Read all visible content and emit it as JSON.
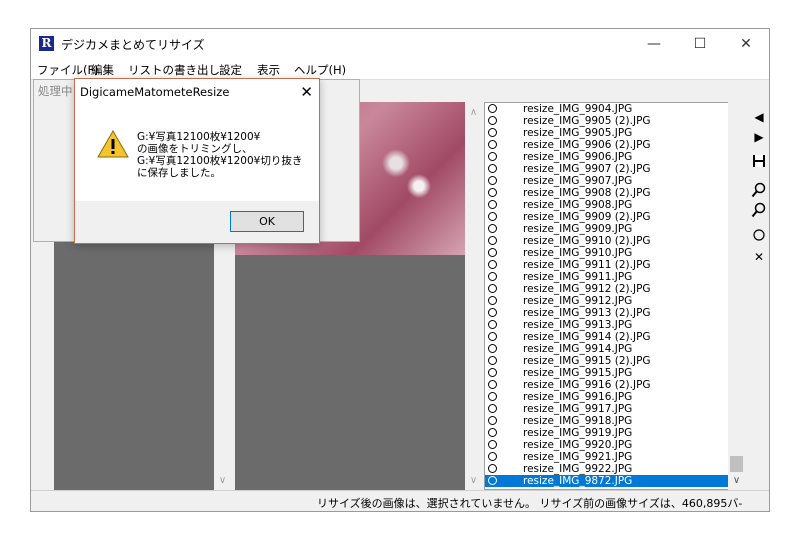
{
  "window": {
    "title": "デジカメまとめてリサイズ",
    "icon_letter": "R",
    "minimize": "—",
    "maximize": "☐",
    "close": "✕"
  },
  "menu": [
    "ファイル(F)",
    "編集",
    "リストの書き出し",
    "設定",
    "表示",
    "ヘルプ(H)"
  ],
  "behind_dialog_title": "処理中",
  "dialog": {
    "title": "DigicameMatometeResize",
    "close": "✕",
    "lines": [
      "G:¥写真12100枚¥1200¥",
      "の画像をトリミングし、",
      "G:¥写真12100枚¥1200¥切り抜き",
      "に保存しました。"
    ],
    "ok_label": "OK"
  },
  "files": [
    "resize_IMG_9904.JPG",
    "resize_IMG_9905 (2).JPG",
    "resize_IMG_9905.JPG",
    "resize_IMG_9906 (2).JPG",
    "resize_IMG_9906.JPG",
    "resize_IMG_9907 (2).JPG",
    "resize_IMG_9907.JPG",
    "resize_IMG_9908 (2).JPG",
    "resize_IMG_9908.JPG",
    "resize_IMG_9909 (2).JPG",
    "resize_IMG_9909.JPG",
    "resize_IMG_9910 (2).JPG",
    "resize_IMG_9910.JPG",
    "resize_IMG_9911 (2).JPG",
    "resize_IMG_9911.JPG",
    "resize_IMG_9912 (2).JPG",
    "resize_IMG_9912.JPG",
    "resize_IMG_9913 (2).JPG",
    "resize_IMG_9913.JPG",
    "resize_IMG_9914 (2).JPG",
    "resize_IMG_9914.JPG",
    "resize_IMG_9915 (2).JPG",
    "resize_IMG_9915.JPG",
    "resize_IMG_9916 (2).JPG",
    "resize_IMG_9916.JPG",
    "resize_IMG_9917.JPG",
    "resize_IMG_9918.JPG",
    "resize_IMG_9919.JPG",
    "resize_IMG_9920.JPG",
    "resize_IMG_9921.JPG",
    "resize_IMG_9922.JPG",
    "resize_IMG_9872.JPG"
  ],
  "selected_file": "resize_IMG_9872.JPG",
  "toolbar_icons": [
    "prev-icon",
    "next-icon",
    "save-icon",
    "zoom-in-icon",
    "zoom-out-icon",
    "circle-icon",
    "cross-icon"
  ],
  "status": "リサイズ後の画像は、選択されていません。 リサイズ前の画像サイズは、460,895バ-",
  "colors": {
    "selection": "#0078d7",
    "panel_gray": "#6b6b6b",
    "dialog_border": "#c07050"
  }
}
